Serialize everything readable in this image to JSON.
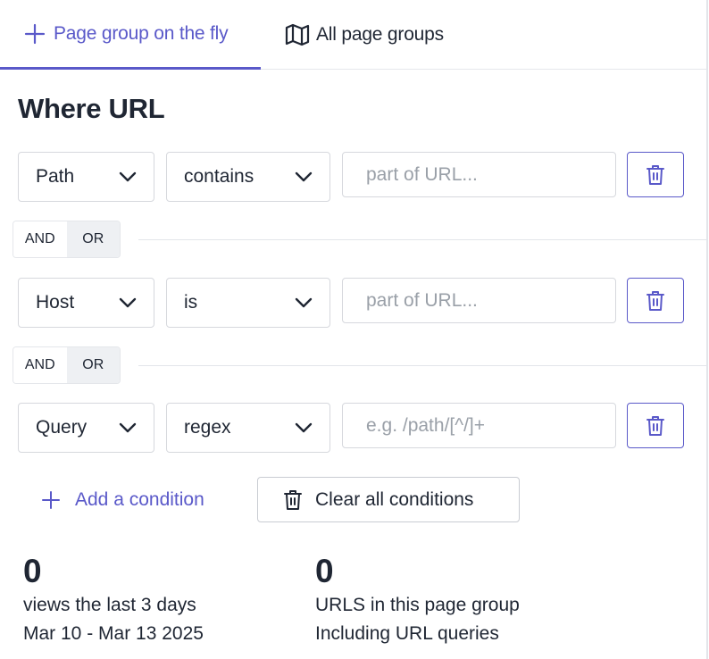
{
  "tabs": [
    {
      "label": "Page group on the fly",
      "icon": "plus-icon",
      "active": true
    },
    {
      "label": "All page groups",
      "icon": "map-icon",
      "active": false
    }
  ],
  "section_title": "Where URL",
  "conditions": [
    {
      "field": "Path",
      "operator": "contains",
      "value": "",
      "placeholder": "part of URL..."
    },
    {
      "field": "Host",
      "operator": "is",
      "value": "",
      "placeholder": "part of URL..."
    },
    {
      "field": "Query",
      "operator": "regex",
      "value": "",
      "placeholder": "e.g. /path/[^/]+"
    }
  ],
  "logic_toggles": [
    {
      "and_label": "AND",
      "or_label": "OR",
      "selected": "OR"
    },
    {
      "and_label": "AND",
      "or_label": "OR",
      "selected": "OR"
    }
  ],
  "actions": {
    "add_condition": "Add a condition",
    "clear_all": "Clear all conditions"
  },
  "stats": {
    "views": {
      "value": "0",
      "line1": "views the last 3 days",
      "line2": "Mar 10 - Mar 13 2025"
    },
    "urls": {
      "value": "0",
      "line1": "URLS in this page group",
      "line2": "Including URL queries"
    }
  },
  "colors": {
    "accent": "#5a59c9",
    "text": "#1f2633",
    "border": "#d6d8dd",
    "placeholder": "#9aa0a8"
  }
}
